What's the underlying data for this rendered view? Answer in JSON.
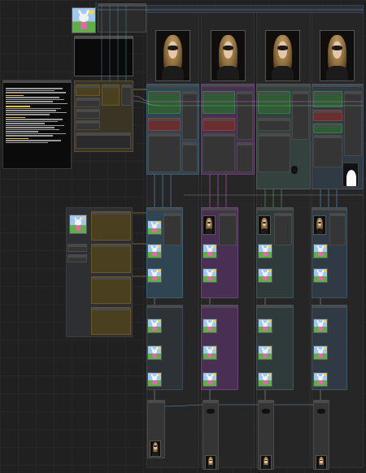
{
  "workflow": {
    "canvas_background": "#202020",
    "group_colors": {
      "dark": "#2d2f33",
      "green": "#2f5b35",
      "red": "#6a2e2e",
      "gold": "#4a3f1f",
      "purple": "#4a2f55",
      "blue": "#2f4552"
    },
    "wire_colors": [
      "#6ab0e0",
      "#d070d0",
      "#e0c050",
      "#70c070",
      "#d05050"
    ]
  },
  "top_header_labels": [
    "",
    "",
    "",
    ""
  ],
  "note_node": {
    "title": "",
    "lines": []
  },
  "columns": [
    {
      "id": "col-1",
      "output_image": "portrait-masquerade"
    },
    {
      "id": "col-2",
      "output_image": "portrait-masquerade"
    },
    {
      "id": "col-3",
      "output_image": "portrait-masquerade"
    },
    {
      "id": "col-4",
      "output_image": "portrait-masquerade"
    }
  ],
  "icons": {
    "reference_image": "cartoon-bunny-image",
    "preview_image": "portrait-masquerade-image",
    "mask_preview": "white-silhouette-mask",
    "small_marker": "butterfly-icon"
  }
}
